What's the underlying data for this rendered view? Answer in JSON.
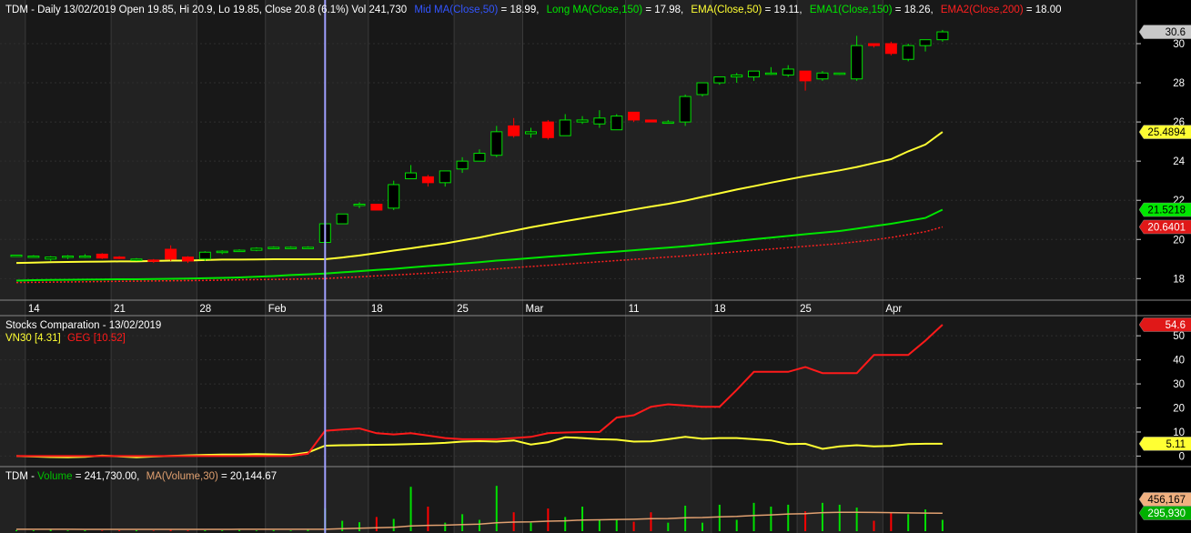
{
  "colors": {
    "background": "#000000",
    "band_dark": "#181818",
    "band_light": "#222222",
    "up_candle": "#00e000",
    "down_candle": "#ff0000",
    "mid_ma": "#ffff33",
    "long_ma": "#00e600",
    "ema2": "#ff2020",
    "vn30": "#ffff33",
    "geg": "#ff1a1a",
    "volume_ma": "#e0a070",
    "cursor": "#a0a0ff",
    "text": "#ffffff",
    "axis_line": "#888888"
  },
  "header": {
    "info_text": "TDM - Daily 13/02/2019 Open 19.85, Hi 20.9, Lo 19.85, Close 20.8 (6.1%) Vol 241,730",
    "mid_ma_text": "Mid MA(Close,50)",
    "mid_ma_value_text": " = 18.99,",
    "long_ma_text": "Long MA(Close,150)",
    "long_ma_value_text": " = 17.98,",
    "ema_text": "EMA(Close,50)",
    "ema_value_text": " = 19.11,",
    "ema1_text": "EMA1(Close,150)",
    "ema1_value_text": " = 18.26,",
    "ema2_text": "EMA2(Close,200)",
    "ema2_value_text": " = 18.00"
  },
  "comparison_header": {
    "title": "Stocks Comparation - 13/02/2019",
    "vn30_label": "VN30 [4.31]",
    "geg_label": "GEG [10.52]"
  },
  "volume_header": {
    "prefix": "TDM - ",
    "volume_label": "Volume",
    "volume_value": " = 241,730.00,",
    "ma_label": "MA(Volume,30)",
    "ma_value": " = 20,144.67"
  },
  "chart_data": [
    {
      "type": "candlestick",
      "title": "TDM - Daily",
      "ylim": [
        16.9,
        31.3
      ],
      "y_ticks": [
        18,
        20,
        22,
        24,
        26,
        28,
        30
      ],
      "x_tick_labels": [
        {
          "label": "14",
          "index": 1
        },
        {
          "label": "21",
          "index": 6
        },
        {
          "label": "28",
          "index": 11
        },
        {
          "label": "Feb",
          "index": 15
        },
        {
          "label": "18",
          "index": 21
        },
        {
          "label": "25",
          "index": 26
        },
        {
          "label": "Mar",
          "index": 30
        },
        {
          "label": "11",
          "index": 36
        },
        {
          "label": "18",
          "index": 41
        },
        {
          "label": "25",
          "index": 46
        },
        {
          "label": "Apr",
          "index": 51
        }
      ],
      "cursor_index": 18,
      "ohlc": [
        [
          19.2,
          19.2,
          19.2,
          19.2
        ],
        [
          19.15,
          19.2,
          19.1,
          19.15
        ],
        [
          19.0,
          19.15,
          18.9,
          19.1
        ],
        [
          19.1,
          19.2,
          19.0,
          19.15
        ],
        [
          19.15,
          19.25,
          19.05,
          19.15
        ],
        [
          19.25,
          19.3,
          19.0,
          19.05
        ],
        [
          19.1,
          19.15,
          19.0,
          19.05
        ],
        [
          19.0,
          19.05,
          18.9,
          19.0
        ],
        [
          18.95,
          19.0,
          18.8,
          18.9
        ],
        [
          19.5,
          19.7,
          18.9,
          19.0
        ],
        [
          19.1,
          19.15,
          18.8,
          18.9
        ],
        [
          19.0,
          19.4,
          18.9,
          19.35
        ],
        [
          19.35,
          19.45,
          19.25,
          19.4
        ],
        [
          19.45,
          19.5,
          19.4,
          19.45
        ],
        [
          19.45,
          19.6,
          19.4,
          19.55
        ],
        [
          19.6,
          19.65,
          19.55,
          19.6
        ],
        [
          19.6,
          19.65,
          19.55,
          19.6
        ],
        [
          19.6,
          19.65,
          19.55,
          19.6
        ],
        [
          19.85,
          20.9,
          19.85,
          20.8
        ],
        [
          20.8,
          21.3,
          20.8,
          21.3
        ],
        [
          21.8,
          21.9,
          21.6,
          21.8
        ],
        [
          21.8,
          21.8,
          21.5,
          21.5
        ],
        [
          21.6,
          23.0,
          21.5,
          22.8
        ],
        [
          23.1,
          23.8,
          23.1,
          23.4
        ],
        [
          23.2,
          23.3,
          22.7,
          22.9
        ],
        [
          22.9,
          23.5,
          22.7,
          23.5
        ],
        [
          23.6,
          24.2,
          23.4,
          24.0
        ],
        [
          24.0,
          24.6,
          24.0,
          24.4
        ],
        [
          24.3,
          25.8,
          24.2,
          25.5
        ],
        [
          25.8,
          26.2,
          25.2,
          25.3
        ],
        [
          25.4,
          25.7,
          25.2,
          25.5
        ],
        [
          26.0,
          26.1,
          25.1,
          25.2
        ],
        [
          25.3,
          26.4,
          25.3,
          26.1
        ],
        [
          26.0,
          26.3,
          25.9,
          26.1
        ],
        [
          25.9,
          26.6,
          25.7,
          26.2
        ],
        [
          25.6,
          26.4,
          25.6,
          26.3
        ],
        [
          26.5,
          26.5,
          26.0,
          26.1
        ],
        [
          26.1,
          26.1,
          26.0,
          26.0
        ],
        [
          26.0,
          26.1,
          26.0,
          26.0
        ],
        [
          26.0,
          27.4,
          25.8,
          27.3
        ],
        [
          27.4,
          28.0,
          27.3,
          28.0
        ],
        [
          28.0,
          28.3,
          27.9,
          28.3
        ],
        [
          28.3,
          28.5,
          28.0,
          28.4
        ],
        [
          28.3,
          28.5,
          28.1,
          28.6
        ],
        [
          28.5,
          28.8,
          28.4,
          28.5
        ],
        [
          28.4,
          28.9,
          28.3,
          28.7
        ],
        [
          28.6,
          28.6,
          27.6,
          28.1
        ],
        [
          28.2,
          28.6,
          28.1,
          28.5
        ],
        [
          28.5,
          28.5,
          28.4,
          28.5
        ],
        [
          28.2,
          30.4,
          28.1,
          29.9
        ],
        [
          30.0,
          30.0,
          29.8,
          29.9
        ],
        [
          30.0,
          30.1,
          29.4,
          29.5
        ],
        [
          29.2,
          30.0,
          29.1,
          29.9
        ],
        [
          29.9,
          30.1,
          29.6,
          30.2
        ],
        [
          30.2,
          30.7,
          30.1,
          30.6
        ]
      ],
      "series": [
        {
          "name": "Mid MA(Close,50)",
          "values": [
            18.8,
            18.82,
            18.84,
            18.85,
            18.86,
            18.87,
            18.88,
            18.88,
            18.9,
            18.92,
            18.92,
            18.95,
            18.97,
            18.97,
            18.98,
            18.99,
            18.99,
            18.99,
            18.99,
            19.08,
            19.18,
            19.3,
            19.43,
            19.55,
            19.68,
            19.8,
            19.95,
            20.1,
            20.28,
            20.45,
            20.62,
            20.78,
            20.93,
            21.08,
            21.23,
            21.38,
            21.53,
            21.68,
            21.82,
            21.98,
            22.17,
            22.36,
            22.55,
            22.72,
            22.9,
            23.07,
            23.23,
            23.38,
            23.53,
            23.7,
            23.9,
            24.1,
            24.5,
            24.85,
            25.49
          ]
        },
        {
          "name": "EMA1(Close,150)",
          "values": [
            17.9,
            17.92,
            17.93,
            17.94,
            17.95,
            17.96,
            17.97,
            17.97,
            17.98,
            17.99,
            18.0,
            18.02,
            18.04,
            18.06,
            18.1,
            18.13,
            18.18,
            18.22,
            18.26,
            18.32,
            18.38,
            18.44,
            18.5,
            18.57,
            18.64,
            18.7,
            18.77,
            18.84,
            18.92,
            18.98,
            19.05,
            19.12,
            19.18,
            19.25,
            19.32,
            19.38,
            19.45,
            19.52,
            19.58,
            19.65,
            19.74,
            19.83,
            19.92,
            20.01,
            20.09,
            20.18,
            20.27,
            20.35,
            20.43,
            20.55,
            20.68,
            20.8,
            20.95,
            21.1,
            21.52
          ]
        },
        {
          "name": "EMA2(Close,200)",
          "values": [
            17.8,
            17.81,
            17.82,
            17.83,
            17.84,
            17.85,
            17.86,
            17.87,
            17.88,
            17.89,
            17.9,
            17.91,
            17.92,
            17.94,
            17.95,
            17.96,
            17.97,
            17.99,
            18.0,
            18.05,
            18.09,
            18.14,
            18.18,
            18.23,
            18.28,
            18.33,
            18.38,
            18.44,
            18.5,
            18.56,
            18.62,
            18.68,
            18.74,
            18.8,
            18.86,
            18.92,
            18.98,
            19.04,
            19.1,
            19.16,
            19.23,
            19.3,
            19.37,
            19.44,
            19.51,
            19.58,
            19.65,
            19.72,
            19.79,
            19.88,
            19.98,
            20.1,
            20.25,
            20.4,
            20.64
          ]
        }
      ],
      "last_labels": [
        {
          "name": "Close",
          "value": "30.6"
        },
        {
          "name": "Mid MA(Close,50)",
          "value": "25.4894"
        },
        {
          "name": "EMA1(Close,150)",
          "value": "21.5218"
        },
        {
          "name": "EMA2(Close,200)",
          "value": "20.6401"
        }
      ]
    },
    {
      "type": "line",
      "title": "Stocks Comparation - 13/02/2019",
      "ylim": [
        -4,
        58
      ],
      "y_ticks": [
        0,
        10,
        20,
        30,
        40,
        50
      ],
      "series": [
        {
          "name": "VN30",
          "values": [
            0,
            -0.2,
            -0.4,
            -0.5,
            -0.3,
            0.2,
            -0.1,
            -0.5,
            -0.2,
            0.1,
            0.3,
            0.5,
            0.6,
            0.6,
            0.8,
            0.7,
            0.5,
            1.5,
            4.31,
            4.5,
            4.6,
            4.7,
            4.8,
            5.0,
            5.2,
            5.5,
            6.0,
            6.2,
            6.0,
            6.5,
            4.8,
            5.8,
            7.8,
            7.5,
            7.0,
            6.8,
            6.0,
            6.1,
            7.0,
            8.0,
            7.2,
            7.5,
            7.5,
            7.0,
            6.5,
            5.0,
            5.1,
            3.0,
            4.0,
            4.5,
            4.0,
            4.2,
            5.0,
            5.1,
            5.11
          ]
        },
        {
          "name": "GEG",
          "values": [
            0,
            0,
            0,
            0,
            0,
            0,
            0,
            0,
            0,
            0,
            0,
            0,
            0,
            0,
            0,
            0,
            0,
            1.0,
            10.52,
            11.0,
            11.5,
            9.5,
            9.0,
            9.5,
            8.5,
            7.5,
            7.0,
            7.0,
            7.0,
            7.5,
            8.0,
            9.5,
            9.8,
            10.0,
            10.0,
            16.0,
            17.0,
            20.5,
            21.5,
            21.0,
            20.5,
            20.5,
            27.5,
            35.0,
            35.0,
            35.0,
            37.0,
            34.5,
            34.5,
            34.5,
            42.0,
            42.0,
            42.0,
            48.0,
            54.6
          ]
        }
      ],
      "last_labels": [
        {
          "name": "GEG",
          "value": "54.6"
        },
        {
          "name": "VN30",
          "value": "5.11"
        }
      ]
    },
    {
      "type": "bar",
      "title": "TDM - Volume",
      "ylim": [
        0,
        520000
      ],
      "series": [
        {
          "name": "Volume",
          "values": [
            12000,
            9000,
            15000,
            8000,
            10000,
            7000,
            9000,
            11000,
            6000,
            14000,
            8000,
            10000,
            9000,
            12000,
            7000,
            11000,
            8000,
            14000,
            241730,
            110000,
            95000,
            150000,
            130000,
            470000,
            260000,
            90000,
            180000,
            120000,
            480000,
            200000,
            90000,
            240000,
            150000,
            260000,
            120000,
            130000,
            100000,
            200000,
            90000,
            270000,
            90000,
            280000,
            120000,
            300000,
            260000,
            280000,
            210000,
            300000,
            280000,
            250000,
            110000,
            200000,
            180000,
            230000,
            120000
          ]
        },
        {
          "name": "MA(Volume,30)",
          "values": [
            20000,
            20000,
            19800,
            19800,
            19700,
            19700,
            19600,
            19600,
            19500,
            19500,
            19500,
            19600,
            19700,
            19800,
            19900,
            20000,
            20100,
            20144.67,
            20144.67,
            27000,
            31000,
            36000,
            40000,
            55000,
            62000,
            64000,
            70000,
            74000,
            90000,
            96000,
            98000,
            106000,
            110000,
            118000,
            120000,
            124000,
            126000,
            132000,
            134000,
            142000,
            144000,
            152000,
            156000,
            166000,
            172000,
            182000,
            186000,
            196000,
            200000,
            200000,
            198000,
            196000,
            194000,
            192000,
            190000
          ]
        }
      ],
      "last_labels": [
        {
          "name": "MA(Volume,30)",
          "value": "456,167"
        },
        {
          "name": "Volume",
          "value": "295,930"
        }
      ]
    }
  ]
}
